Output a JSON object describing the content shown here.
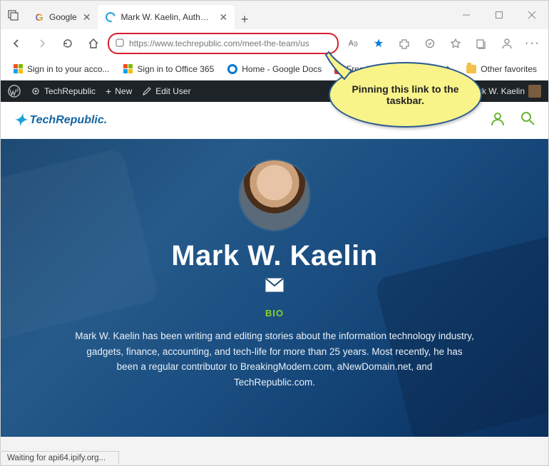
{
  "tabs": [
    {
      "title": "Google",
      "fav": "G"
    },
    {
      "title": "Mark W. Kaelin, Author at TechR",
      "fav": "tr"
    }
  ],
  "address": {
    "url": "https://www.techrepublic.com/meet-the-team/us"
  },
  "bookmarks": [
    {
      "label": "Sign in to your acco...",
      "fav": "ms"
    },
    {
      "label": "Sign in to Office 365",
      "fav": "ms"
    },
    {
      "label": "Home - Google Docs",
      "fav": "donut"
    },
    {
      "label": "Free is: Do Your F...",
      "fav": "f"
    }
  ],
  "bookmarks_overflow": "Other favorites",
  "adminbar": {
    "site": "TechRepublic",
    "new": "New",
    "edit": "Edit User",
    "greeting": "Mark W. Kaelin"
  },
  "site": {
    "brand": "TechRepublic."
  },
  "hero": {
    "name": "Mark W. Kaelin",
    "bio_label": "BIO",
    "bio_text": "Mark W. Kaelin has been writing and editing stories about the information technology industry, gadgets, finance, accounting, and tech-life for more than 25 years. Most recently, he has been a regular contributor to BreakingModern.com, aNewDomain.net, and TechRepublic.com."
  },
  "callout": "Pinning this link to the taskbar.",
  "status": "Waiting for api64.ipify.org..."
}
